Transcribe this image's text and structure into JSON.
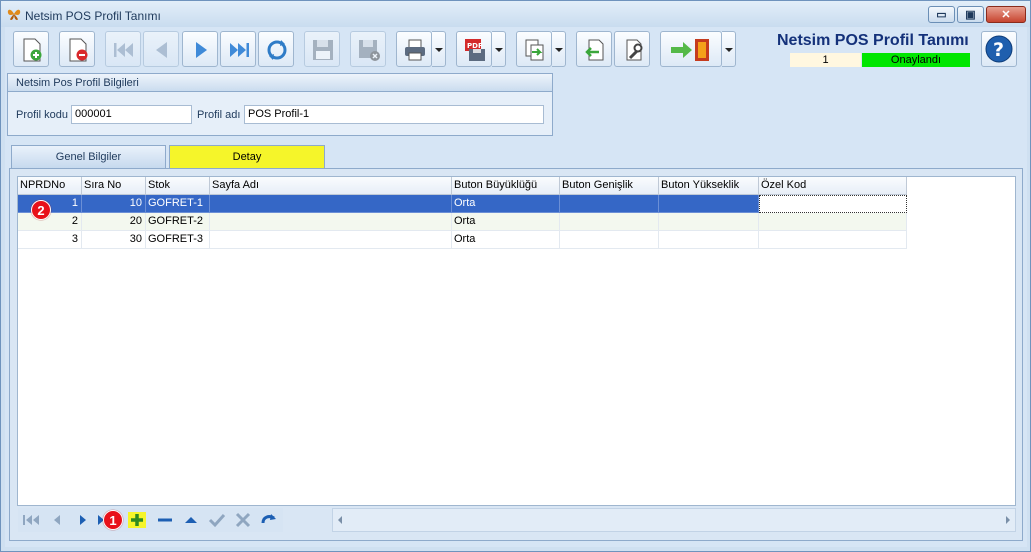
{
  "window": {
    "title": "Netsim POS Profil Tanımı",
    "minimize_glyph": "▭",
    "maximize_glyph": "▣",
    "close_glyph": "✕"
  },
  "header": {
    "form_title": "Netsim POS Profil Tanımı",
    "record_no": "1",
    "status": "Onaylandı",
    "status_color": "#00e600"
  },
  "toolbar": {
    "buttons": [
      {
        "name": "new-record-icon",
        "enabled": true
      },
      {
        "name": "delete-record-icon",
        "enabled": true
      },
      {
        "name": "first-record-icon",
        "enabled": false
      },
      {
        "name": "previous-record-icon",
        "enabled": false
      },
      {
        "name": "next-record-icon",
        "enabled": true
      },
      {
        "name": "last-record-icon",
        "enabled": true
      },
      {
        "name": "refresh-icon",
        "enabled": true
      },
      {
        "name": "save-icon",
        "enabled": false
      },
      {
        "name": "cancel-save-icon",
        "enabled": false
      },
      {
        "name": "print-icon",
        "enabled": true
      },
      {
        "name": "pdf-export-icon",
        "enabled": true
      },
      {
        "name": "export-icon",
        "enabled": true
      },
      {
        "name": "import-icon",
        "enabled": true
      },
      {
        "name": "settings-icon",
        "enabled": true
      },
      {
        "name": "exit-icon",
        "enabled": true
      },
      {
        "name": "help-icon",
        "enabled": true
      }
    ]
  },
  "profile_group": {
    "title": "Netsim Pos Profil Bilgileri",
    "code_label": "Profil kodu",
    "code_value": "000001",
    "name_label": "Profil adı",
    "name_value": "POS Profil-1"
  },
  "tabs": [
    {
      "label": "Genel Bilgiler",
      "active": false
    },
    {
      "label": "Detay",
      "active": true
    }
  ],
  "grid": {
    "columns": [
      "NPRDNo",
      "Sıra No",
      "Stok",
      "Sayfa Adı",
      "Buton Büyüklüğü",
      "Buton Genişlik",
      "Buton Yükseklik",
      "Özel Kod"
    ],
    "rows": [
      [
        "1",
        "10",
        "GOFRET-1",
        "",
        "Orta",
        "",
        "",
        ""
      ],
      [
        "2",
        "20",
        "GOFRET-2",
        "",
        "Orta",
        "",
        "",
        ""
      ],
      [
        "3",
        "30",
        "GOFRET-3",
        "",
        "Orta",
        "",
        "",
        ""
      ]
    ],
    "selected_row": 0
  },
  "annotations": {
    "badge_1": "1",
    "badge_2": "2"
  },
  "navigator": {
    "buttons": [
      "nav-first-icon",
      "nav-prev-icon",
      "nav-next-icon",
      "nav-last-icon",
      "add-row-icon",
      "delete-row-icon",
      "move-up-icon",
      "confirm-icon",
      "cancel-icon",
      "undo-icon"
    ]
  }
}
